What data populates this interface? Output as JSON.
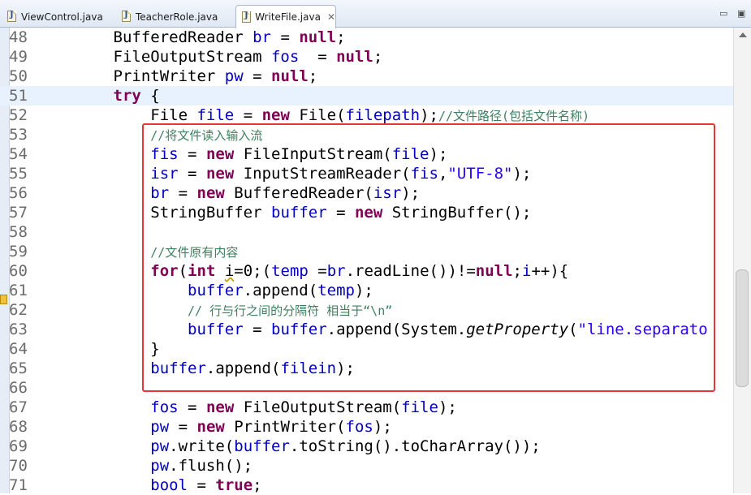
{
  "tabs": [
    {
      "label": "ViewControl.java",
      "icon": "java-file-icon",
      "active": false
    },
    {
      "label": "TeacherRole.java",
      "icon": "java-file-icon",
      "active": false
    },
    {
      "label": "WriteFile.java",
      "icon": "java-file-icon",
      "active": true
    }
  ],
  "window_controls": {
    "minimize": "▭",
    "maximize": "▣"
  },
  "editor": {
    "current_line": 51,
    "highlight_color": "#e83434",
    "lines": [
      {
        "n": "48",
        "tokens": [
          [
            "",
            "        "
          ],
          [
            "",
            "BufferedReader "
          ],
          [
            "fld",
            "br"
          ],
          [
            "",
            " = "
          ],
          [
            "kw",
            "null"
          ],
          [
            "",
            ";"
          ]
        ]
      },
      {
        "n": "49",
        "tokens": [
          [
            "",
            "        "
          ],
          [
            "",
            "FileOutputStream "
          ],
          [
            "fld",
            "fos"
          ],
          [
            "",
            "  = "
          ],
          [
            "kw",
            "null"
          ],
          [
            "",
            ";"
          ]
        ]
      },
      {
        "n": "50",
        "tokens": [
          [
            "",
            "        "
          ],
          [
            "",
            "PrintWriter "
          ],
          [
            "fld",
            "pw"
          ],
          [
            "",
            " = "
          ],
          [
            "kw",
            "null"
          ],
          [
            "",
            ";"
          ]
        ]
      },
      {
        "n": "51",
        "tokens": [
          [
            "",
            "        "
          ],
          [
            "kw",
            "try"
          ],
          [
            "",
            " {"
          ]
        ]
      },
      {
        "n": "52",
        "tokens": [
          [
            "",
            "            "
          ],
          [
            "",
            "File "
          ],
          [
            "fld",
            "file"
          ],
          [
            "",
            " = "
          ],
          [
            "kw",
            "new"
          ],
          [
            "",
            " File("
          ],
          [
            "fld",
            "filepath"
          ],
          [
            "",
            ");"
          ],
          [
            "cmt",
            "//文件路径(包括文件名称)"
          ]
        ]
      },
      {
        "n": "53",
        "tokens": [
          [
            "",
            "            "
          ],
          [
            "cmt",
            "//将文件读入输入流"
          ]
        ]
      },
      {
        "n": "54",
        "tokens": [
          [
            "",
            "            "
          ],
          [
            "fld",
            "fis"
          ],
          [
            "",
            " = "
          ],
          [
            "kw",
            "new"
          ],
          [
            "",
            " FileInputStream("
          ],
          [
            "fld",
            "file"
          ],
          [
            "",
            ");"
          ]
        ]
      },
      {
        "n": "55",
        "tokens": [
          [
            "",
            "            "
          ],
          [
            "fld",
            "isr"
          ],
          [
            "",
            " = "
          ],
          [
            "kw",
            "new"
          ],
          [
            "",
            " InputStreamReader("
          ],
          [
            "fld",
            "fis"
          ],
          [
            "",
            ","
          ],
          [
            "str",
            "\"UTF-8\""
          ],
          [
            "",
            ");"
          ]
        ]
      },
      {
        "n": "56",
        "tokens": [
          [
            "",
            "            "
          ],
          [
            "fld",
            "br"
          ],
          [
            "",
            " = "
          ],
          [
            "kw",
            "new"
          ],
          [
            "",
            " BufferedReader("
          ],
          [
            "fld",
            "isr"
          ],
          [
            "",
            ");"
          ]
        ]
      },
      {
        "n": "57",
        "tokens": [
          [
            "",
            "            "
          ],
          [
            "",
            "StringBuffer "
          ],
          [
            "fld",
            "buffer"
          ],
          [
            "",
            " = "
          ],
          [
            "kw",
            "new"
          ],
          [
            "",
            " StringBuffer();"
          ]
        ]
      },
      {
        "n": "58",
        "tokens": []
      },
      {
        "n": "59",
        "tokens": [
          [
            "",
            "            "
          ],
          [
            "cmt",
            "//文件原有内容"
          ]
        ]
      },
      {
        "n": "60",
        "tokens": [
          [
            "",
            "            "
          ],
          [
            "kw",
            "for"
          ],
          [
            "",
            "("
          ],
          [
            "kw",
            "int"
          ],
          [
            "",
            " "
          ],
          [
            "warn",
            "i"
          ],
          [
            "",
            "=0;("
          ],
          [
            "fld",
            "temp"
          ],
          [
            "",
            " ="
          ],
          [
            "fld",
            "br"
          ],
          [
            "",
            ".readLine())!="
          ],
          [
            "kw",
            "null"
          ],
          [
            "",
            ";"
          ],
          [
            "fld",
            "i"
          ],
          [
            "",
            "++){"
          ]
        ]
      },
      {
        "n": "61",
        "tokens": [
          [
            "",
            "                "
          ],
          [
            "fld",
            "buffer"
          ],
          [
            "",
            ".append("
          ],
          [
            "fld",
            "temp"
          ],
          [
            "",
            ");"
          ]
        ]
      },
      {
        "n": "62",
        "tokens": [
          [
            "",
            "                "
          ],
          [
            "cmt",
            "// 行与行之间的分隔符 相当于“\\n”"
          ]
        ]
      },
      {
        "n": "63",
        "tokens": [
          [
            "",
            "                "
          ],
          [
            "fld",
            "buffer"
          ],
          [
            "",
            " = "
          ],
          [
            "fld",
            "buffer"
          ],
          [
            "",
            ".append(System."
          ],
          [
            "static",
            "getProperty"
          ],
          [
            "",
            "("
          ],
          [
            "str",
            "\"line.separato"
          ]
        ]
      },
      {
        "n": "64",
        "tokens": [
          [
            "",
            "            "
          ],
          [
            "",
            "}"
          ]
        ]
      },
      {
        "n": "65",
        "tokens": [
          [
            "",
            "            "
          ],
          [
            "fld",
            "buffer"
          ],
          [
            "",
            ".append("
          ],
          [
            "fld",
            "filein"
          ],
          [
            "",
            ");"
          ]
        ]
      },
      {
        "n": "66",
        "tokens": []
      },
      {
        "n": "67",
        "tokens": [
          [
            "",
            "            "
          ],
          [
            "fld",
            "fos"
          ],
          [
            "",
            " = "
          ],
          [
            "kw",
            "new"
          ],
          [
            "",
            " FileOutputStream("
          ],
          [
            "fld",
            "file"
          ],
          [
            "",
            ");"
          ]
        ]
      },
      {
        "n": "68",
        "tokens": [
          [
            "",
            "            "
          ],
          [
            "fld",
            "pw"
          ],
          [
            "",
            " = "
          ],
          [
            "kw",
            "new"
          ],
          [
            "",
            " PrintWriter("
          ],
          [
            "fld",
            "fos"
          ],
          [
            "",
            ");"
          ]
        ]
      },
      {
        "n": "69",
        "tokens": [
          [
            "",
            "            "
          ],
          [
            "fld",
            "pw"
          ],
          [
            "",
            ".write("
          ],
          [
            "fld",
            "buffer"
          ],
          [
            "",
            ".toString().toCharArray());"
          ]
        ]
      },
      {
        "n": "70",
        "tokens": [
          [
            "",
            "            "
          ],
          [
            "fld",
            "pw"
          ],
          [
            "",
            ".flush();"
          ]
        ]
      },
      {
        "n": "71",
        "tokens": [
          [
            "",
            "            "
          ],
          [
            "fld",
            "bool"
          ],
          [
            "",
            " = "
          ],
          [
            "kw",
            "true"
          ],
          [
            "",
            ";"
          ]
        ]
      }
    ]
  }
}
